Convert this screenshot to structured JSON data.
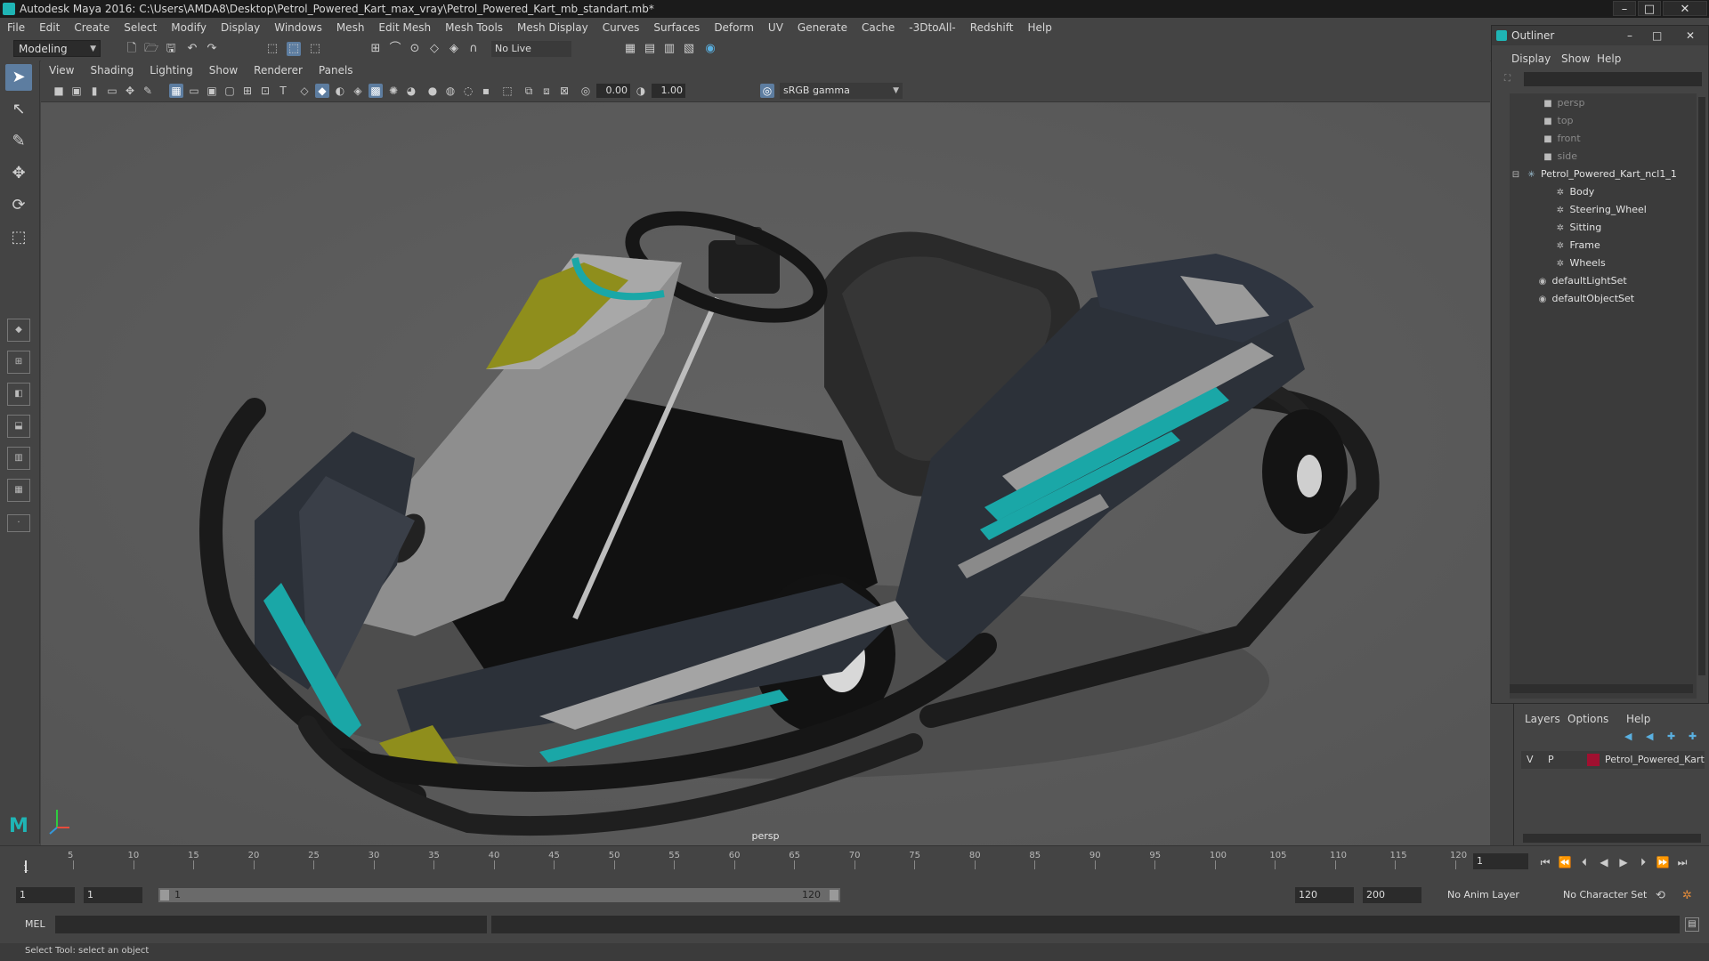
{
  "titlebar": {
    "title": "Autodesk Maya 2016: C:\\Users\\AMDA8\\Desktop\\Petrol_Powered_Kart_max_vray\\Petrol_Powered_Kart_mb_standart.mb*"
  },
  "menubar": [
    "File",
    "Edit",
    "Create",
    "Select",
    "Modify",
    "Display",
    "Windows",
    "Mesh",
    "Edit Mesh",
    "Mesh Tools",
    "Mesh Display",
    "Curves",
    "Surfaces",
    "Deform",
    "UV",
    "Generate",
    "Cache",
    "-3DtoAll-",
    "Redshift",
    "Help"
  ],
  "statusline": {
    "mode": "Modeling",
    "live_surface": "No Live Surface"
  },
  "panel": {
    "menus": [
      "View",
      "Shading",
      "Lighting",
      "Show",
      "Renderer",
      "Panels"
    ],
    "exposure": "0.00",
    "gamma_value": "1.00",
    "colorspace": "sRGB gamma",
    "camera": "persp"
  },
  "outliner": {
    "title": "Outliner",
    "menus": [
      "Display",
      "Show",
      "Help"
    ],
    "items": [
      {
        "label": "persp",
        "type": "camera"
      },
      {
        "label": "top",
        "type": "camera"
      },
      {
        "label": "front",
        "type": "camera"
      },
      {
        "label": "side",
        "type": "camera"
      },
      {
        "label": "Petrol_Powered_Kart_ncl1_1",
        "type": "group"
      },
      {
        "label": "Body",
        "type": "mesh"
      },
      {
        "label": "Steering_Wheel",
        "type": "mesh"
      },
      {
        "label": "Sitting",
        "type": "mesh"
      },
      {
        "label": "Frame",
        "type": "mesh"
      },
      {
        "label": "Wheels",
        "type": "mesh"
      },
      {
        "label": "defaultLightSet",
        "type": "set"
      },
      {
        "label": "defaultObjectSet",
        "type": "set"
      }
    ]
  },
  "layers": {
    "menus": [
      "Layers",
      "Options",
      "Help"
    ],
    "row": {
      "v": "V",
      "p": "P",
      "name": "Petrol_Powered_Kart",
      "color": "#a01030"
    }
  },
  "timeline": {
    "ticks": [
      "5",
      "10",
      "15",
      "20",
      "25",
      "30",
      "35",
      "40",
      "45",
      "50",
      "55",
      "60",
      "65",
      "70",
      "75",
      "80",
      "85",
      "90",
      "95",
      "100",
      "105",
      "110",
      "115",
      "120"
    ],
    "start_label": "1",
    "current_frame": "1"
  },
  "range": {
    "start": "1",
    "anim_start": "1",
    "bar_start": "1",
    "bar_end": "120",
    "end": "120",
    "anim_end": "200",
    "anim_layer": "No Anim Layer",
    "char_set": "No Character Set"
  },
  "cmd": {
    "label": "MEL"
  },
  "help": {
    "text": "Select Tool: select an object"
  },
  "colors": {
    "accent": "#5d7da0",
    "teal": "#1fb5b5",
    "viewport_bg": "#5a5a5a"
  }
}
